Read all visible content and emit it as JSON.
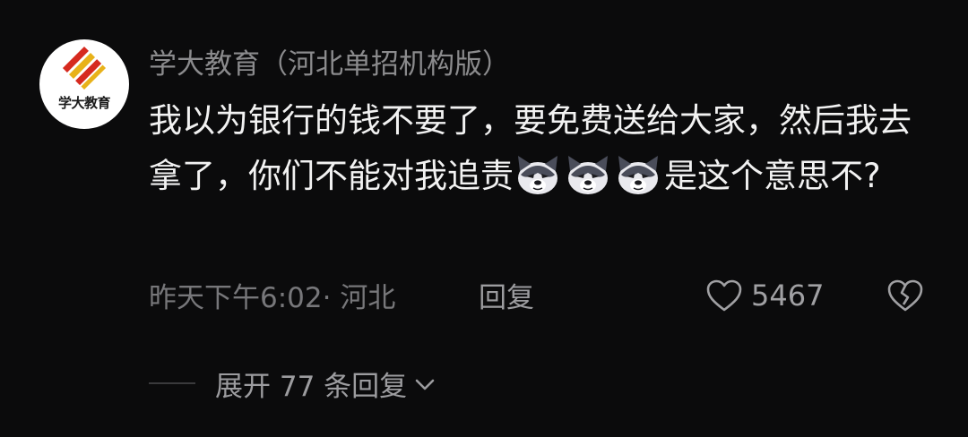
{
  "comment": {
    "author": "学大教育（河北单招机构版）",
    "avatar_text": "学大教育",
    "text_part1": "我以为银行的钱不要了，要免费送给大家，然后我去拿了，你们不能对我追责",
    "text_part2": "是这个意思不?",
    "emoji_icon": "husky-dog-emoji",
    "emoji_count": 3,
    "time_location": "昨天下午6:02· 河北",
    "reply_label": "回复",
    "like_count": "5467",
    "expand_label": "展开 77 条回复"
  },
  "colors": {
    "background": "#0b0b0c",
    "author": "#8b8b8d",
    "body_text": "#f2f2f2",
    "meta": "#77777a",
    "logo_red": "#d62a1f",
    "logo_gold": "#e8b21a"
  }
}
